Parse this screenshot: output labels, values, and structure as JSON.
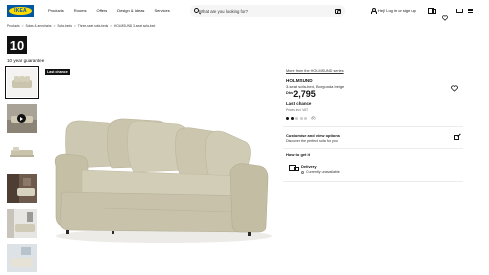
{
  "header": {
    "logo_text": "IKEA",
    "nav": [
      "Products",
      "Rooms",
      "Offers",
      "Design & Ideas",
      "Services"
    ],
    "search_placeholder": "What are you looking for?",
    "login_text": "Hej! Log in or sign up"
  },
  "breadcrumb": [
    "Products",
    "Sofas & armchairs",
    "Sofa-beds",
    "Three-seat sofa-beds",
    "HOLMSUND 3-seat sofa-bed"
  ],
  "badge": {
    "number": "10",
    "warranty": "10 year guarantee"
  },
  "image_label": "Last chance",
  "product": {
    "series_link": "More from the HOLMSUND series",
    "name": "HOLMSUND",
    "description": "3-seat sofa-bed, Borgunda beige",
    "currency": "Dhs",
    "price": "2,795",
    "last_chance": "Last chance",
    "price_note": "Prices incl. VAT",
    "rating_stars": 2,
    "rating_count": "(0)"
  },
  "customize": {
    "title": "Customise and view options",
    "subtitle": "Discover the perfect sofa for you"
  },
  "fulfilment": {
    "heading": "How to get it",
    "delivery_title": "Delivery",
    "delivery_status": "Currently unavailable"
  },
  "colors": {
    "brand_blue": "#0058a3",
    "brand_yellow": "#ffdb00",
    "sofa_fabric": "#c9c4ab"
  }
}
